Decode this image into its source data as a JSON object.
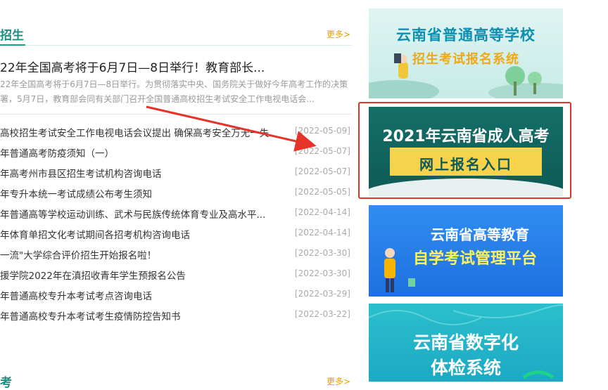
{
  "section1": {
    "title": "招生",
    "more": "更多>"
  },
  "headline": {
    "title": "22年全国高考将于6月7日—8日举行！教育部长...",
    "summary": "22年全国高考将于6月7日—8日举行。为贯彻落实中央、国务院关于做好今年高考工作的决策署，5月7日，教育部会同有关部门召开全国普通高校招生考试安全工作电视电话会..."
  },
  "news": [
    {
      "title": "高校招生考试安全工作电视电话会议提出 确保高考安全万无一失",
      "date": "[2022-05-09]"
    },
    {
      "title": "年普通高考防疫须知（一）",
      "date": "[2022-05-07]"
    },
    {
      "title": "年高考州市县区招生考试机构咨询电话",
      "date": "[2022-05-07]"
    },
    {
      "title": "年专升本统一考试成绩公布考生须知",
      "date": "[2022-05-05]"
    },
    {
      "title": "年普通高等学校运动训练、武术与民族传统体育专业及高水平...",
      "date": "[2022-04-14]"
    },
    {
      "title": "年体育单招文化考试期间各招考机构咨询电话",
      "date": "[2022-04-14]"
    },
    {
      "title": "一流\"大学综合评价招生开始报名啦！",
      "date": "[2022-03-30]"
    },
    {
      "title": "援学院2022年在滇招收青年学生预报名公告",
      "date": "[2022-03-30]"
    },
    {
      "title": "年普通高校专升本考试考点咨询电话",
      "date": "[2022-03-29]"
    },
    {
      "title": "年普通高校专升本考试考生疫情防控告知书",
      "date": "[2022-03-22]"
    }
  ],
  "section2": {
    "title": "考",
    "more": "更多>"
  },
  "banners": {
    "b1": {
      "line1": "云南省普通高等学校",
      "line2": "招生考试报名系统"
    },
    "b2": {
      "line1": "2021年云南省成人高考",
      "line2": "网上报名入口"
    },
    "b3": {
      "line1": "云南省高等教育",
      "line2": "自学考试管理平台"
    },
    "b4": {
      "line1": "云南省数字化",
      "line2": "体检系统"
    }
  },
  "colors": {
    "accent": "#1b8f7e",
    "more": "#e8a000",
    "highlight": "#e63228",
    "arrow": "#e63228"
  }
}
